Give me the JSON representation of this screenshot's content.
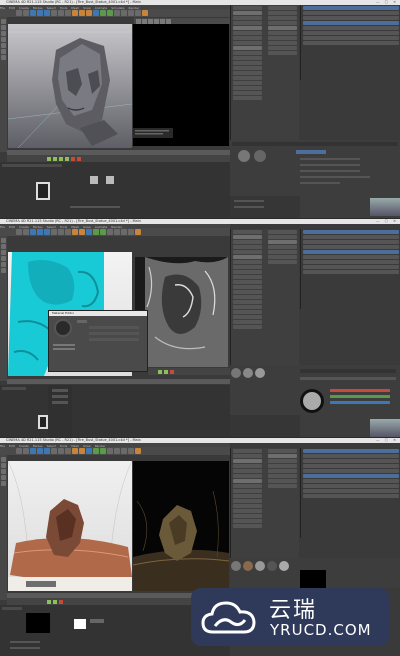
{
  "panels": [
    {
      "title": "CINEMA 4D R21.115 Studio (RC - R21) - [Fire_Bust_Statue_4001.c4d *] - Main"
    },
    {
      "title": "CINEMA 4D R21.115 Studio (RC - R21) - [Fire_Bust_Statue_4001.c4d *] - Main"
    },
    {
      "title": "CINEMA 4D R21.115 Studio (RC - R21) - [Fire_Bust_Statue_4001.c4d *] - Main"
    }
  ],
  "menu": [
    "File",
    "Edit",
    "Create",
    "Modes",
    "Select",
    "Tools",
    "Mesh",
    "Snap",
    "Animate",
    "Simulate",
    "Tracker",
    "Render",
    "Extensions",
    "Window",
    "Help"
  ],
  "dialog": {
    "title": "Material Editor"
  },
  "colors": {
    "accent": "#3d78b5",
    "cyan_bust": "#18c9d6",
    "stone": "#7a4a36",
    "play": "#8fbf5a"
  },
  "watermark": {
    "cn": "云瑞",
    "en": "YRUCD.COM"
  }
}
